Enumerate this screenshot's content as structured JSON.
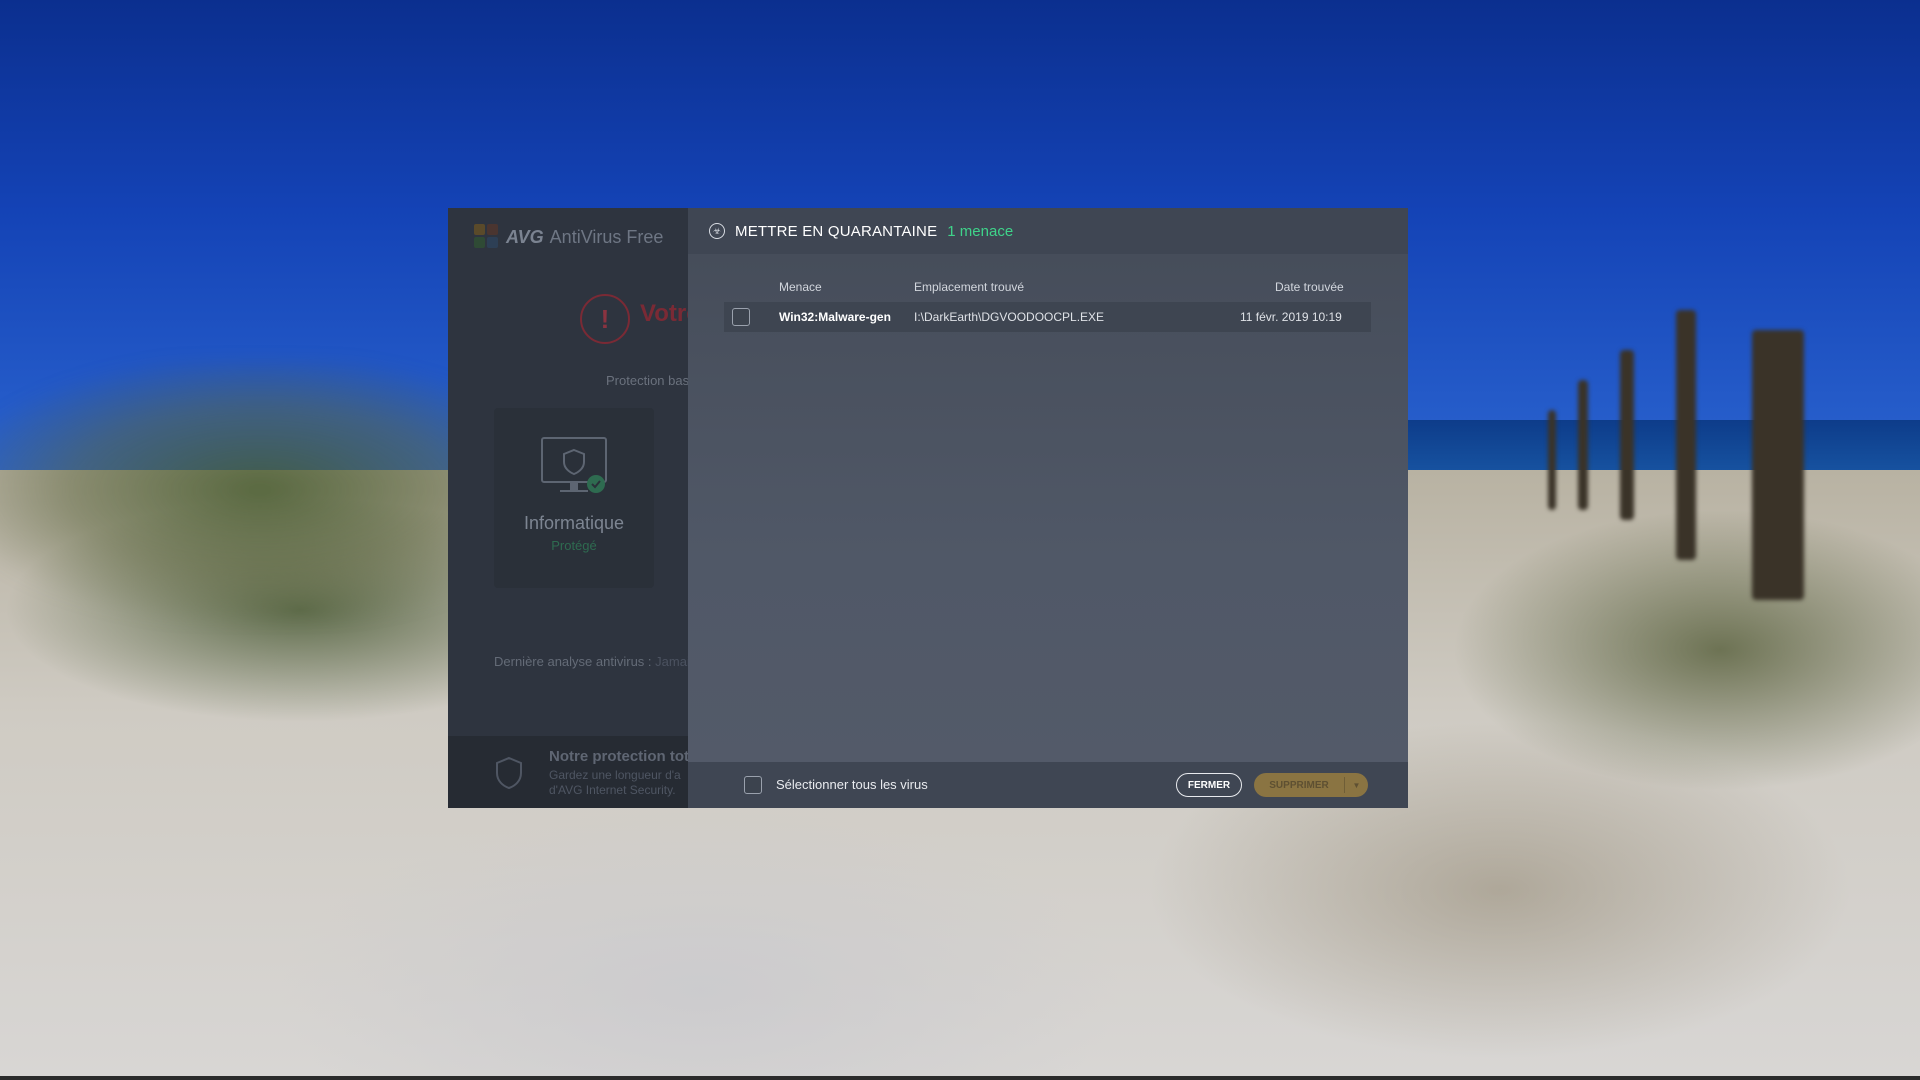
{
  "app": {
    "brand": "AVG",
    "product": "AntiVirus Free",
    "alert_title": "Votre",
    "protection_label": "Protection bas",
    "card_title": "Informatique",
    "card_status": "Protégé",
    "last_scan_label": "Dernière analyse antivirus :",
    "last_scan_value": "Jamai",
    "promo_title": "Notre protection tota",
    "promo_line1": "Gardez une longueur d'a",
    "promo_line2": "d'AVG Internet Security."
  },
  "dialog": {
    "title": "METTRE EN QUARANTAINE",
    "threat_count": "1 menace",
    "columns": {
      "threat": "Menace",
      "location": "Emplacement trouvé",
      "date": "Date trouvée"
    },
    "rows": [
      {
        "threat": "Win32:Malware-gen",
        "location": "I:\\DarkEarth\\DGVOODOOCPL.EXE",
        "date": "11 févr. 2019 10:19",
        "checked": false
      }
    ],
    "select_all_label": "Sélectionner tous les virus",
    "close_button": "FERMER",
    "delete_button": "SUPPRIMER"
  },
  "colors": {
    "accent_green": "#3fd38a",
    "delete_button": "#8a7442",
    "dialog_header": "#3f4653"
  }
}
